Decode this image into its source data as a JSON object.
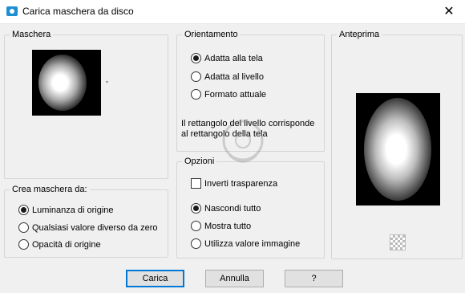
{
  "window": {
    "title": "Carica maschera da disco",
    "close_glyph": "✕"
  },
  "maschera": {
    "label": "Maschera"
  },
  "orientamento": {
    "label": "Orientamento",
    "options": [
      {
        "label": "Adatta alla tela",
        "selected": true
      },
      {
        "label": "Adatta al livello",
        "selected": false
      },
      {
        "label": "Formato attuale",
        "selected": false
      }
    ],
    "note": "Il rettangolo del livello corrisponde al rettangolo della tela"
  },
  "anteprima": {
    "label": "Anteprima"
  },
  "crea": {
    "label": "Crea maschera da:",
    "options": [
      {
        "label": "Luminanza di origine",
        "selected": true
      },
      {
        "label": "Qualsiasi valore diverso da zero",
        "selected": false
      },
      {
        "label": "Opacità di origine",
        "selected": false
      }
    ]
  },
  "opzioni": {
    "label": "Opzioni",
    "invert_label": "Inverti trasparenza",
    "invert_checked": false,
    "options": [
      {
        "label": "Nascondi tutto",
        "selected": true
      },
      {
        "label": "Mostra tutto",
        "selected": false
      },
      {
        "label": "Utilizza valore immagine",
        "selected": false
      }
    ]
  },
  "buttons": {
    "ok": "Carica",
    "cancel": "Annulla",
    "help": "?"
  },
  "colors": {
    "accent": "#0078d7",
    "dialog_bg": "#f0f0f0"
  }
}
